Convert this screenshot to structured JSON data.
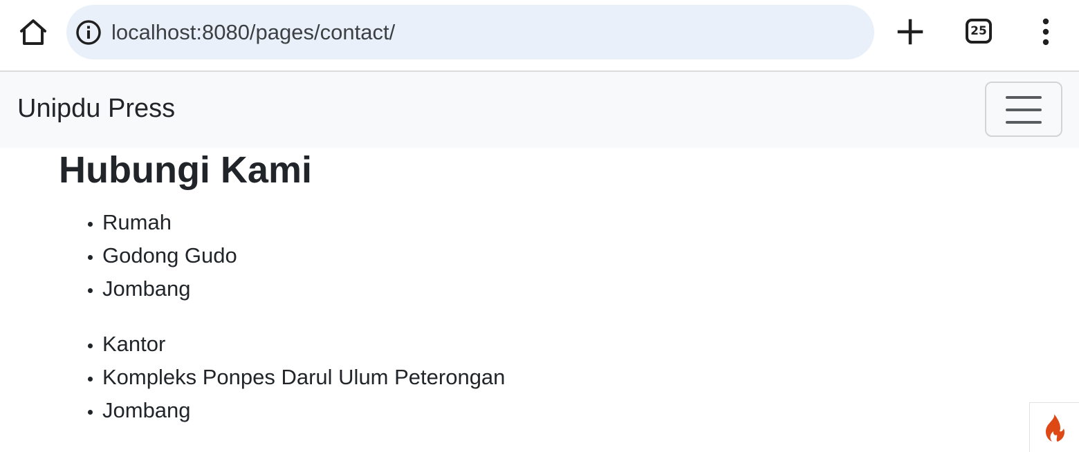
{
  "browser": {
    "url_host": "localhost",
    "url_rest": ":8080/pages/contact/",
    "tab_count": "25"
  },
  "navbar": {
    "brand": "Unipdu Press"
  },
  "main": {
    "title": "Hubungi Kami",
    "home_list": [
      "Rumah",
      "Godong Gudo",
      "Jombang"
    ],
    "office_list": [
      "Kantor",
      "Kompleks Ponpes Darul Ulum Peterongan",
      "Jombang"
    ]
  },
  "icons": {
    "home": "home-icon",
    "info": "info-icon",
    "new_tab": "plus-icon",
    "menu": "more-vert-icon",
    "toggler": "hamburger-icon",
    "debug": "flame-icon"
  },
  "colors": {
    "navbar_bg": "#f8f9fa",
    "url_bar_bg": "#eaf0fa",
    "text": "#212529",
    "flame": "#dd4814"
  }
}
